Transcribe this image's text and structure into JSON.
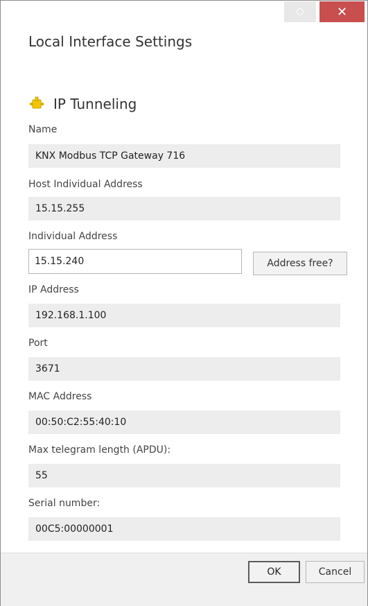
{
  "window": {
    "close_glyph": "✕",
    "title": "Local Interface Settings"
  },
  "section": {
    "title": "IP Tunneling",
    "icon": "ip-tunneling-icon"
  },
  "fields": {
    "name": {
      "label": "Name",
      "value": "KNX Modbus TCP Gateway 716"
    },
    "host_individual_address": {
      "label": "Host Individual Address",
      "value": "15.15.255"
    },
    "individual_address": {
      "label": "Individual Address",
      "value": "15.15.240",
      "button": "Address free?"
    },
    "ip_address": {
      "label": "IP Address",
      "value": "192.168.1.100"
    },
    "port": {
      "label": "Port",
      "value": "3671"
    },
    "mac_address": {
      "label": "MAC Address",
      "value": "00:50:C2:55:40:10"
    },
    "max_telegram_length": {
      "label": "Max telegram length (APDU):",
      "value": "55"
    },
    "serial_number": {
      "label": "Serial number:",
      "value": "00C5:00000001"
    }
  },
  "footer": {
    "ok_label": "OK",
    "cancel_label": "Cancel"
  },
  "colors": {
    "close_button": "#c94f4f",
    "field_background": "#ededed",
    "icon_yellow": "#f2c500"
  }
}
